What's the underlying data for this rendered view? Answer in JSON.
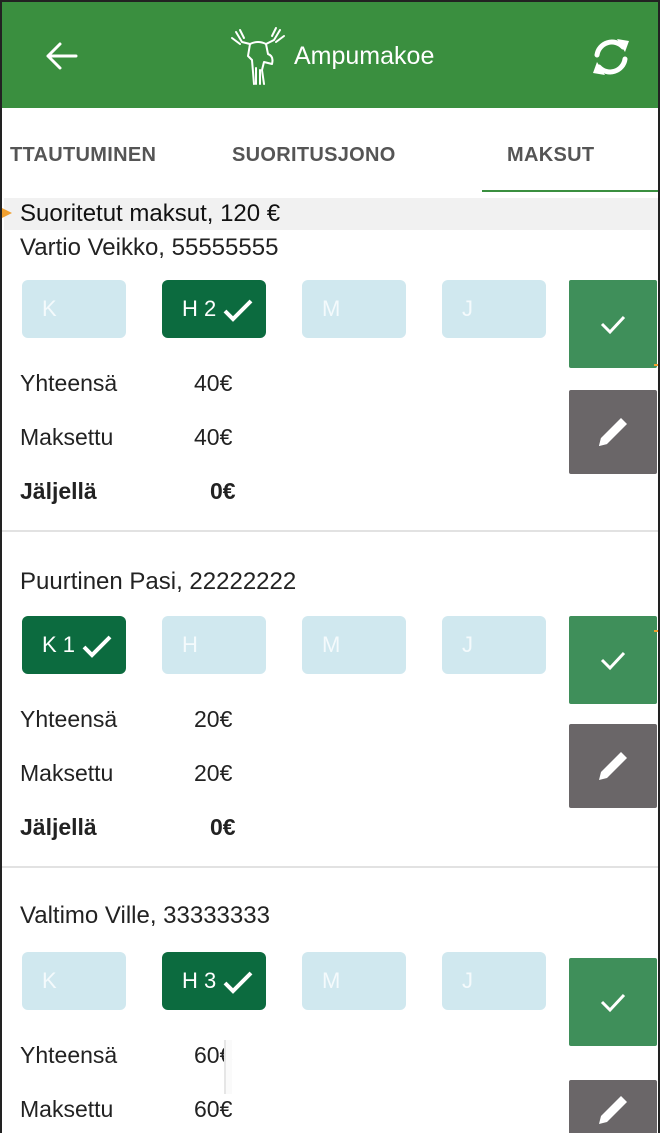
{
  "app": {
    "title": "Ampumakoe",
    "logo_icon": "moose-icon",
    "back_icon": "arrow-left-icon",
    "refresh_icon": "refresh-icon",
    "bar_color": "#3a8f3f"
  },
  "tabs": [
    {
      "label": "TTAUTUMINEN"
    },
    {
      "label": "SUORITUSJONO"
    },
    {
      "label": "MAKSUT",
      "selected": true
    }
  ],
  "summary": {
    "text": "Suoritetut maksut, 120 €"
  },
  "cards": [
    {
      "name": "Vartio Veikko, 55555555",
      "chips": [
        {
          "label": "K",
          "active": false
        },
        {
          "label": "H 2",
          "active": true
        },
        {
          "label": "M",
          "active": false
        },
        {
          "label": "J",
          "active": false
        }
      ],
      "total_label": "Yhteensä",
      "total": "40€",
      "paid_label": "Maksettu",
      "paid": "40€",
      "remaining_label": "Jäljellä",
      "remaining": "0€"
    },
    {
      "name": "Puurtinen Pasi, 22222222",
      "chips": [
        {
          "label": "K 1",
          "active": true
        },
        {
          "label": "H",
          "active": false
        },
        {
          "label": "M",
          "active": false
        },
        {
          "label": "J",
          "active": false
        }
      ],
      "total_label": "Yhteensä",
      "total": "20€",
      "paid_label": "Maksettu",
      "paid": "20€",
      "remaining_label": "Jäljellä",
      "remaining": "0€"
    },
    {
      "name": "Valtimo Ville, 33333333",
      "chips": [
        {
          "label": "K",
          "active": false
        },
        {
          "label": "H 3",
          "active": true
        },
        {
          "label": "M",
          "active": false
        },
        {
          "label": "J",
          "active": false
        }
      ],
      "total_label": "Yhteensä",
      "total": "60€",
      "paid_label": "Maksettu",
      "paid": "60€"
    }
  ],
  "colors": {
    "chip_active": "#0c6b3f",
    "chip_inactive": "#d0e8ef",
    "confirm_button": "#3f8f5a",
    "edit_button": "#6a6668"
  }
}
